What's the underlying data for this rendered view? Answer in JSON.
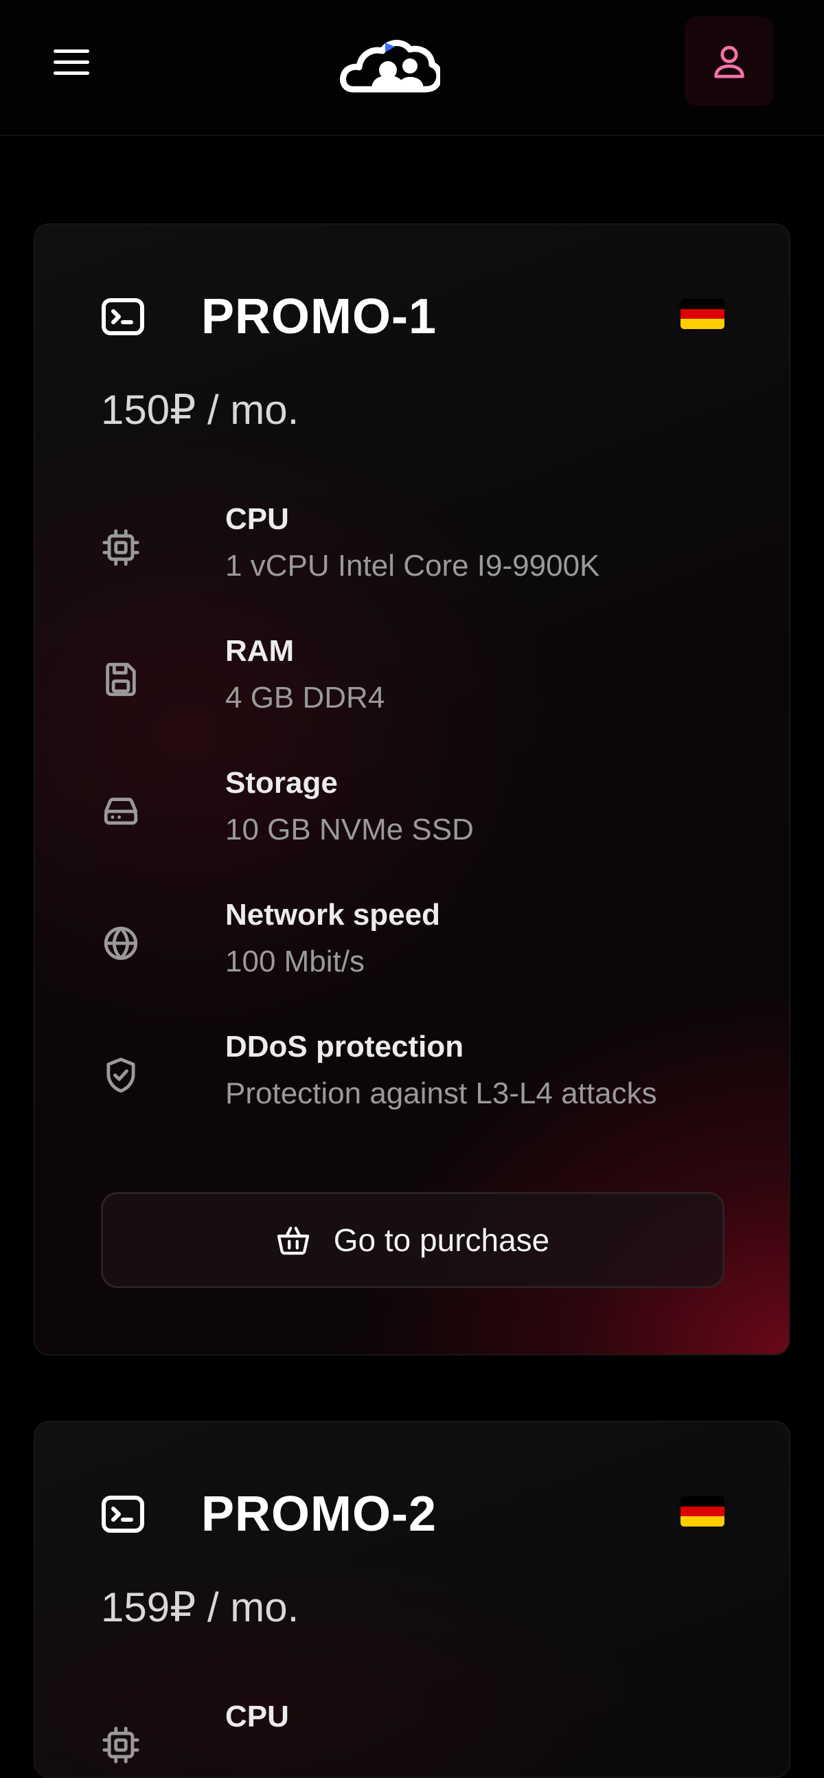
{
  "header": {
    "menu_icon": "hamburger-menu-icon",
    "logo_icon": "cloud-logo-icon",
    "user_icon": "user-icon",
    "accent": "#f472a8"
  },
  "plans": [
    {
      "name": "PROMO-1",
      "price": "150₽ / mo.",
      "flag": "germany-flag-icon",
      "specs": [
        {
          "icon": "cpu-icon",
          "title": "CPU",
          "value": "1 vCPU Intel Core I9-9900K"
        },
        {
          "icon": "ram-icon",
          "title": "RAM",
          "value": "4 GB DDR4"
        },
        {
          "icon": "storage-icon",
          "title": "Storage",
          "value": "10 GB NVMe SSD"
        },
        {
          "icon": "globe-icon",
          "title": "Network speed",
          "value": "100 Mbit/s"
        },
        {
          "icon": "shield-check-icon",
          "title": "DDoS protection",
          "value": "Protection against L3-L4 attacks"
        }
      ],
      "button_label": "Go to purchase"
    },
    {
      "name": "PROMO-2",
      "price": "159₽ / mo.",
      "flag": "germany-flag-icon",
      "specs": [
        {
          "icon": "cpu-icon",
          "title": "CPU"
        }
      ]
    }
  ],
  "colors": {
    "background": "#000000",
    "flag_black": "#000000",
    "flag_red": "#dd0000",
    "flag_gold": "#ffce00"
  }
}
